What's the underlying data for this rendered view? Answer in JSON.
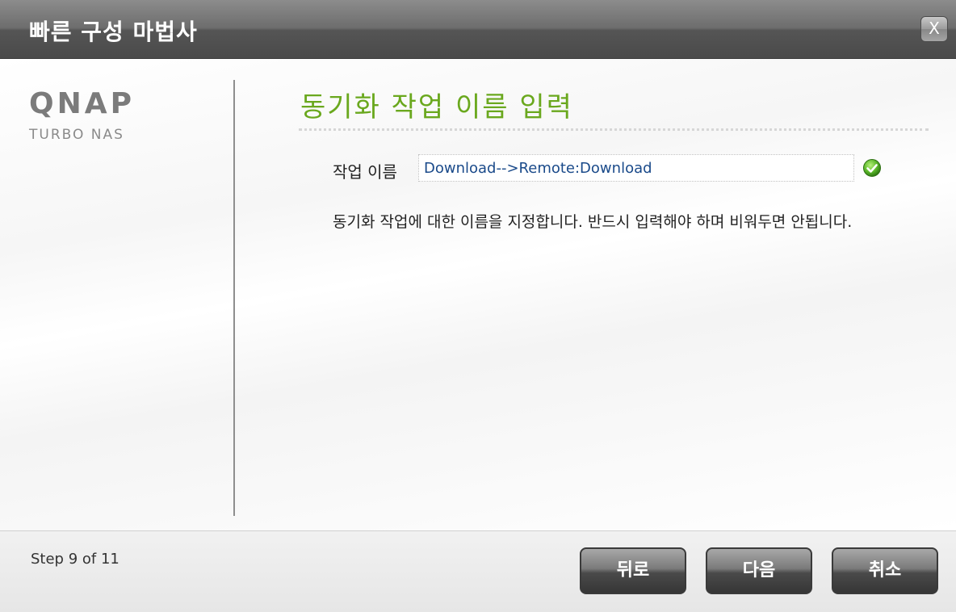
{
  "window": {
    "title": "빠른 구성 마법사",
    "close_label": "X"
  },
  "logo": {
    "brand": "QNAP",
    "product": "TURBO NAS"
  },
  "main": {
    "heading": "동기화 작업 이름 입력",
    "job_name_label": "작업 이름",
    "job_name_value": "Download-->Remote:Download",
    "validation_icon": "check-circle-icon",
    "description": "동기화 작업에 대한 이름을 지정합니다. 반드시 입력해야 하며 비워두면 안됩니다."
  },
  "footer": {
    "step_text": "Step 9 of 11",
    "back_label": "뒤로",
    "next_label": "다음",
    "cancel_label": "취소"
  },
  "colors": {
    "heading_green": "#6aa81e",
    "titlebar_gray": "#6d6d6d",
    "validation_green": "#5cb82a"
  }
}
